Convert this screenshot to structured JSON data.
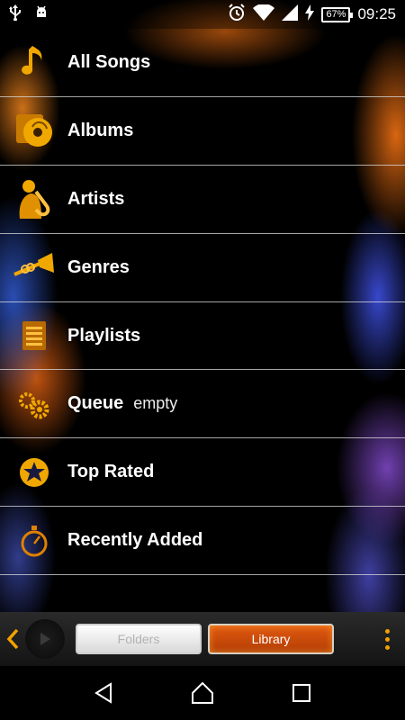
{
  "status_bar": {
    "left_icons": [
      "usb-icon",
      "android-debug-icon"
    ],
    "right_icons": [
      "alarm-icon",
      "wifi-icon",
      "signal-icon",
      "charging-icon"
    ],
    "battery": "67%",
    "time": "09:25"
  },
  "menu": {
    "items": [
      {
        "label": "All Songs",
        "icon": "music-note-icon"
      },
      {
        "label": "Albums",
        "icon": "album-disc-icon"
      },
      {
        "label": "Artists",
        "icon": "saxophone-player-icon"
      },
      {
        "label": "Genres",
        "icon": "trumpet-icon"
      },
      {
        "label": "Playlists",
        "icon": "playlist-icon"
      },
      {
        "label": "Queue",
        "sublabel": "empty",
        "icon": "queue-gears-icon"
      },
      {
        "label": "Top Rated",
        "icon": "star-icon"
      },
      {
        "label": "Recently Added",
        "icon": "stopwatch-icon"
      }
    ]
  },
  "toolbar": {
    "tabs": [
      {
        "label": "Folders",
        "active": false
      },
      {
        "label": "Library",
        "active": true
      }
    ],
    "accent_color": "#f2a200"
  },
  "navigation": {
    "buttons": [
      "back-icon",
      "home-icon",
      "recents-icon"
    ]
  }
}
